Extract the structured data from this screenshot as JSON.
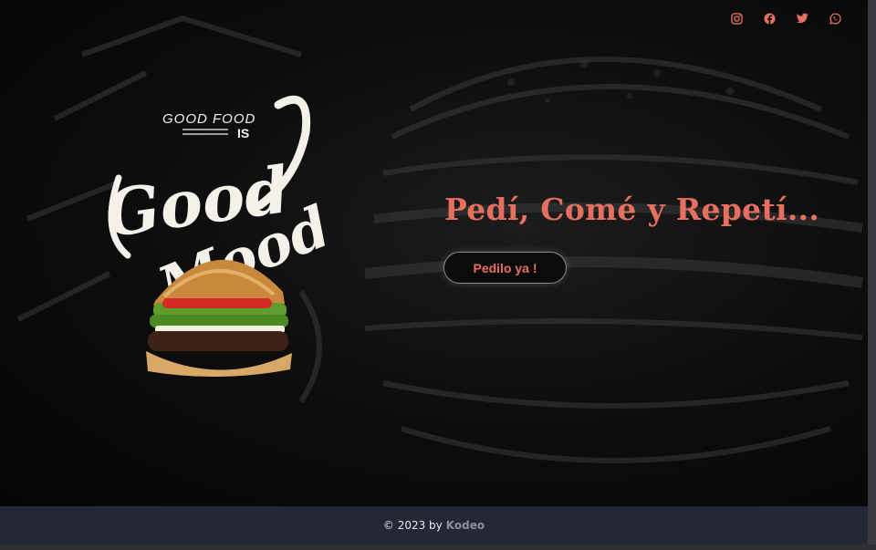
{
  "social": {
    "icons": [
      "instagram-icon",
      "facebook-icon",
      "twitter-icon",
      "whatsapp-icon"
    ],
    "color": "#e5705f"
  },
  "logo": {
    "line1": "GOOD FOOD",
    "line2": "IS",
    "line3": "Good",
    "line4": "Mood"
  },
  "hero": {
    "headline": "Pedí, Comé y Repetí...",
    "cta_label": "Pedilo ya !"
  },
  "footer": {
    "copyright": "© 2023 by",
    "brand": "Kodeo"
  },
  "colors": {
    "accent": "#e5705f",
    "footer_bg": "#262736",
    "hero_bg": "#0b0b0b"
  }
}
